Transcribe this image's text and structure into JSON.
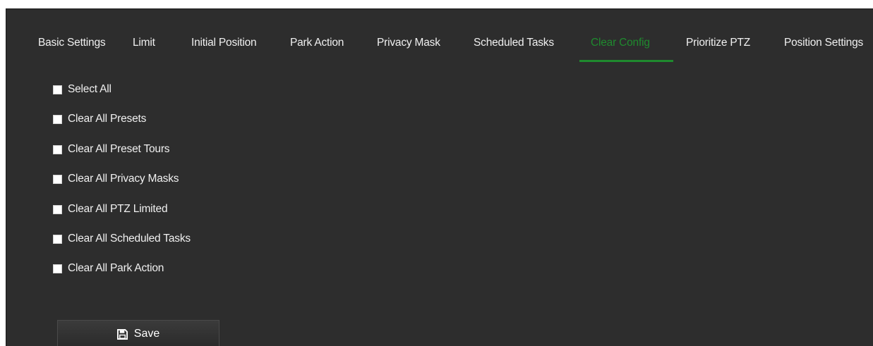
{
  "tabs": [
    {
      "label": "Basic Settings",
      "active": false
    },
    {
      "label": "Limit",
      "active": false
    },
    {
      "label": "Initial Position",
      "active": false
    },
    {
      "label": "Park Action",
      "active": false
    },
    {
      "label": "Privacy Mask",
      "active": false
    },
    {
      "label": "Scheduled Tasks",
      "active": false
    },
    {
      "label": "Clear Config",
      "active": true
    },
    {
      "label": "Prioritize PTZ",
      "active": false
    },
    {
      "label": "Position Settings",
      "active": false
    }
  ],
  "options": [
    {
      "label": "Select All",
      "checked": false
    },
    {
      "label": "Clear All Presets",
      "checked": false
    },
    {
      "label": "Clear All Preset Tours",
      "checked": false
    },
    {
      "label": "Clear All Privacy Masks",
      "checked": false
    },
    {
      "label": "Clear All PTZ Limited",
      "checked": false
    },
    {
      "label": "Clear All Scheduled Tasks",
      "checked": false
    },
    {
      "label": "Clear All Park Action",
      "checked": false
    }
  ],
  "save": {
    "label": "Save",
    "icon": "floppy-disk-icon"
  },
  "colors": {
    "background": "#2d2d2d",
    "active_tab": "#1f8a2e",
    "text": "#f0f0f0"
  }
}
